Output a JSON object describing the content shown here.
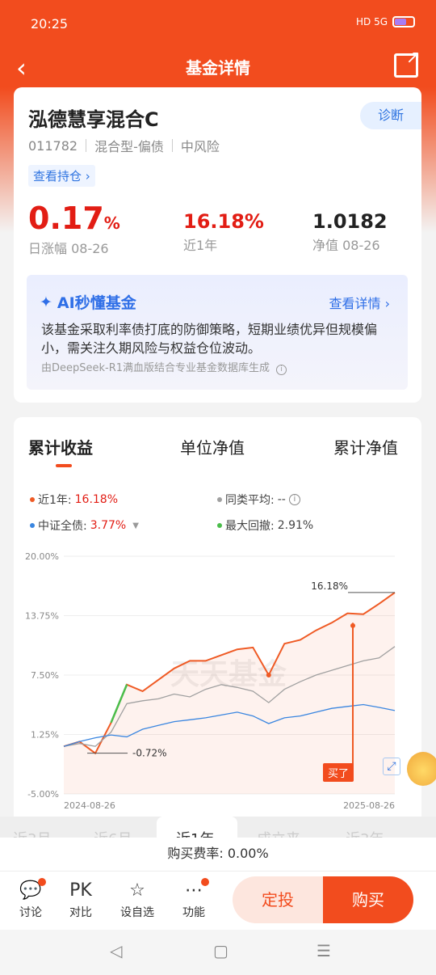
{
  "status_bar": {
    "time": "20:25",
    "icons": "HD 5G"
  },
  "nav": {
    "title": "基金详情"
  },
  "fund": {
    "name": "泓德慧享混合C",
    "diagnose_label": "诊断",
    "code": "011782",
    "category": "混合型-偏债",
    "risk": "中风险",
    "holdings_label": "查看持仓 ›",
    "daily_value": "0.17",
    "daily_unit": "%",
    "daily_label": "日涨幅 08-26",
    "year_value": "16.18%",
    "year_label": "近1年",
    "nav_value": "1.0182",
    "nav_label": "净值 08-26"
  },
  "ai": {
    "title": "AI秒懂基金",
    "detail_label": "查看详情 ›",
    "text": "该基金采取利率债打底的防御策略，短期业绩优异但规模偏小，需关注久期风险与权益仓位波动。",
    "footer": "由DeepSeek-R1满血版结合专业基金数据库生成"
  },
  "chart_tabs": [
    "累计收益",
    "单位净值",
    "累计净值"
  ],
  "legend": {
    "year_label": "近1年:",
    "year_value": "16.18%",
    "peer_label": "同类平均:",
    "peer_value": "--",
    "index_label": "中证全债:",
    "index_value": "3.77%",
    "drawdown_label": "最大回撤:",
    "drawdown_value": "2.91%"
  },
  "colors": {
    "fund": "#ef5a24",
    "peer": "#a0a0a0",
    "index": "#3a86e0",
    "drawdown": "#4bbd4b",
    "accent": "#f24c1e"
  },
  "chart_data": {
    "type": "line",
    "y_ticks": [
      "20.00%",
      "13.75%",
      "7.50%",
      "1.25%",
      "-5.00%"
    ],
    "ylim": [
      -5,
      20
    ],
    "x_labels": [
      "2024-08-26",
      "2025-08-26"
    ],
    "max_label": "16.18%",
    "min_label": "-0.72%",
    "buy_label": "买了",
    "watermark": "天天基金",
    "series": [
      {
        "name": "近1年",
        "values": [
          0,
          0.5,
          -0.72,
          2.5,
          6.5,
          5.8,
          7.0,
          8.2,
          9.0,
          9.0,
          9.6,
          10.2,
          10.4,
          7.5,
          10.8,
          11.2,
          12.2,
          13.0,
          14.0,
          13.9,
          15.0,
          16.18
        ]
      },
      {
        "name": "同类平均",
        "values": [
          0,
          0.3,
          0.0,
          1.5,
          4.5,
          4.8,
          5.0,
          5.5,
          5.2,
          6.0,
          6.5,
          6.2,
          5.8,
          4.6,
          6.0,
          6.8,
          7.5,
          8.0,
          8.5,
          9.0,
          9.3,
          10.5
        ]
      },
      {
        "name": "中证全债",
        "values": [
          0,
          0.5,
          0.9,
          1.2,
          1.0,
          1.8,
          2.2,
          2.6,
          2.8,
          3.0,
          3.3,
          3.6,
          3.2,
          2.4,
          3.0,
          3.2,
          3.6,
          4.0,
          4.2,
          4.4,
          4.1,
          3.77
        ]
      }
    ]
  },
  "periods": [
    "近3月",
    "近6月",
    "近1年",
    "成立来",
    "近3年"
  ],
  "fee": {
    "label": "购买费率: 0.00%"
  },
  "actions": [
    {
      "icon": "💬",
      "label": "讨论"
    },
    {
      "icon": "PK",
      "label": "对比"
    },
    {
      "icon": "☆",
      "label": "设自选"
    },
    {
      "icon": "⋯",
      "label": "功能"
    }
  ],
  "buttons": {
    "dingtou": "定投",
    "buy": "购买"
  }
}
